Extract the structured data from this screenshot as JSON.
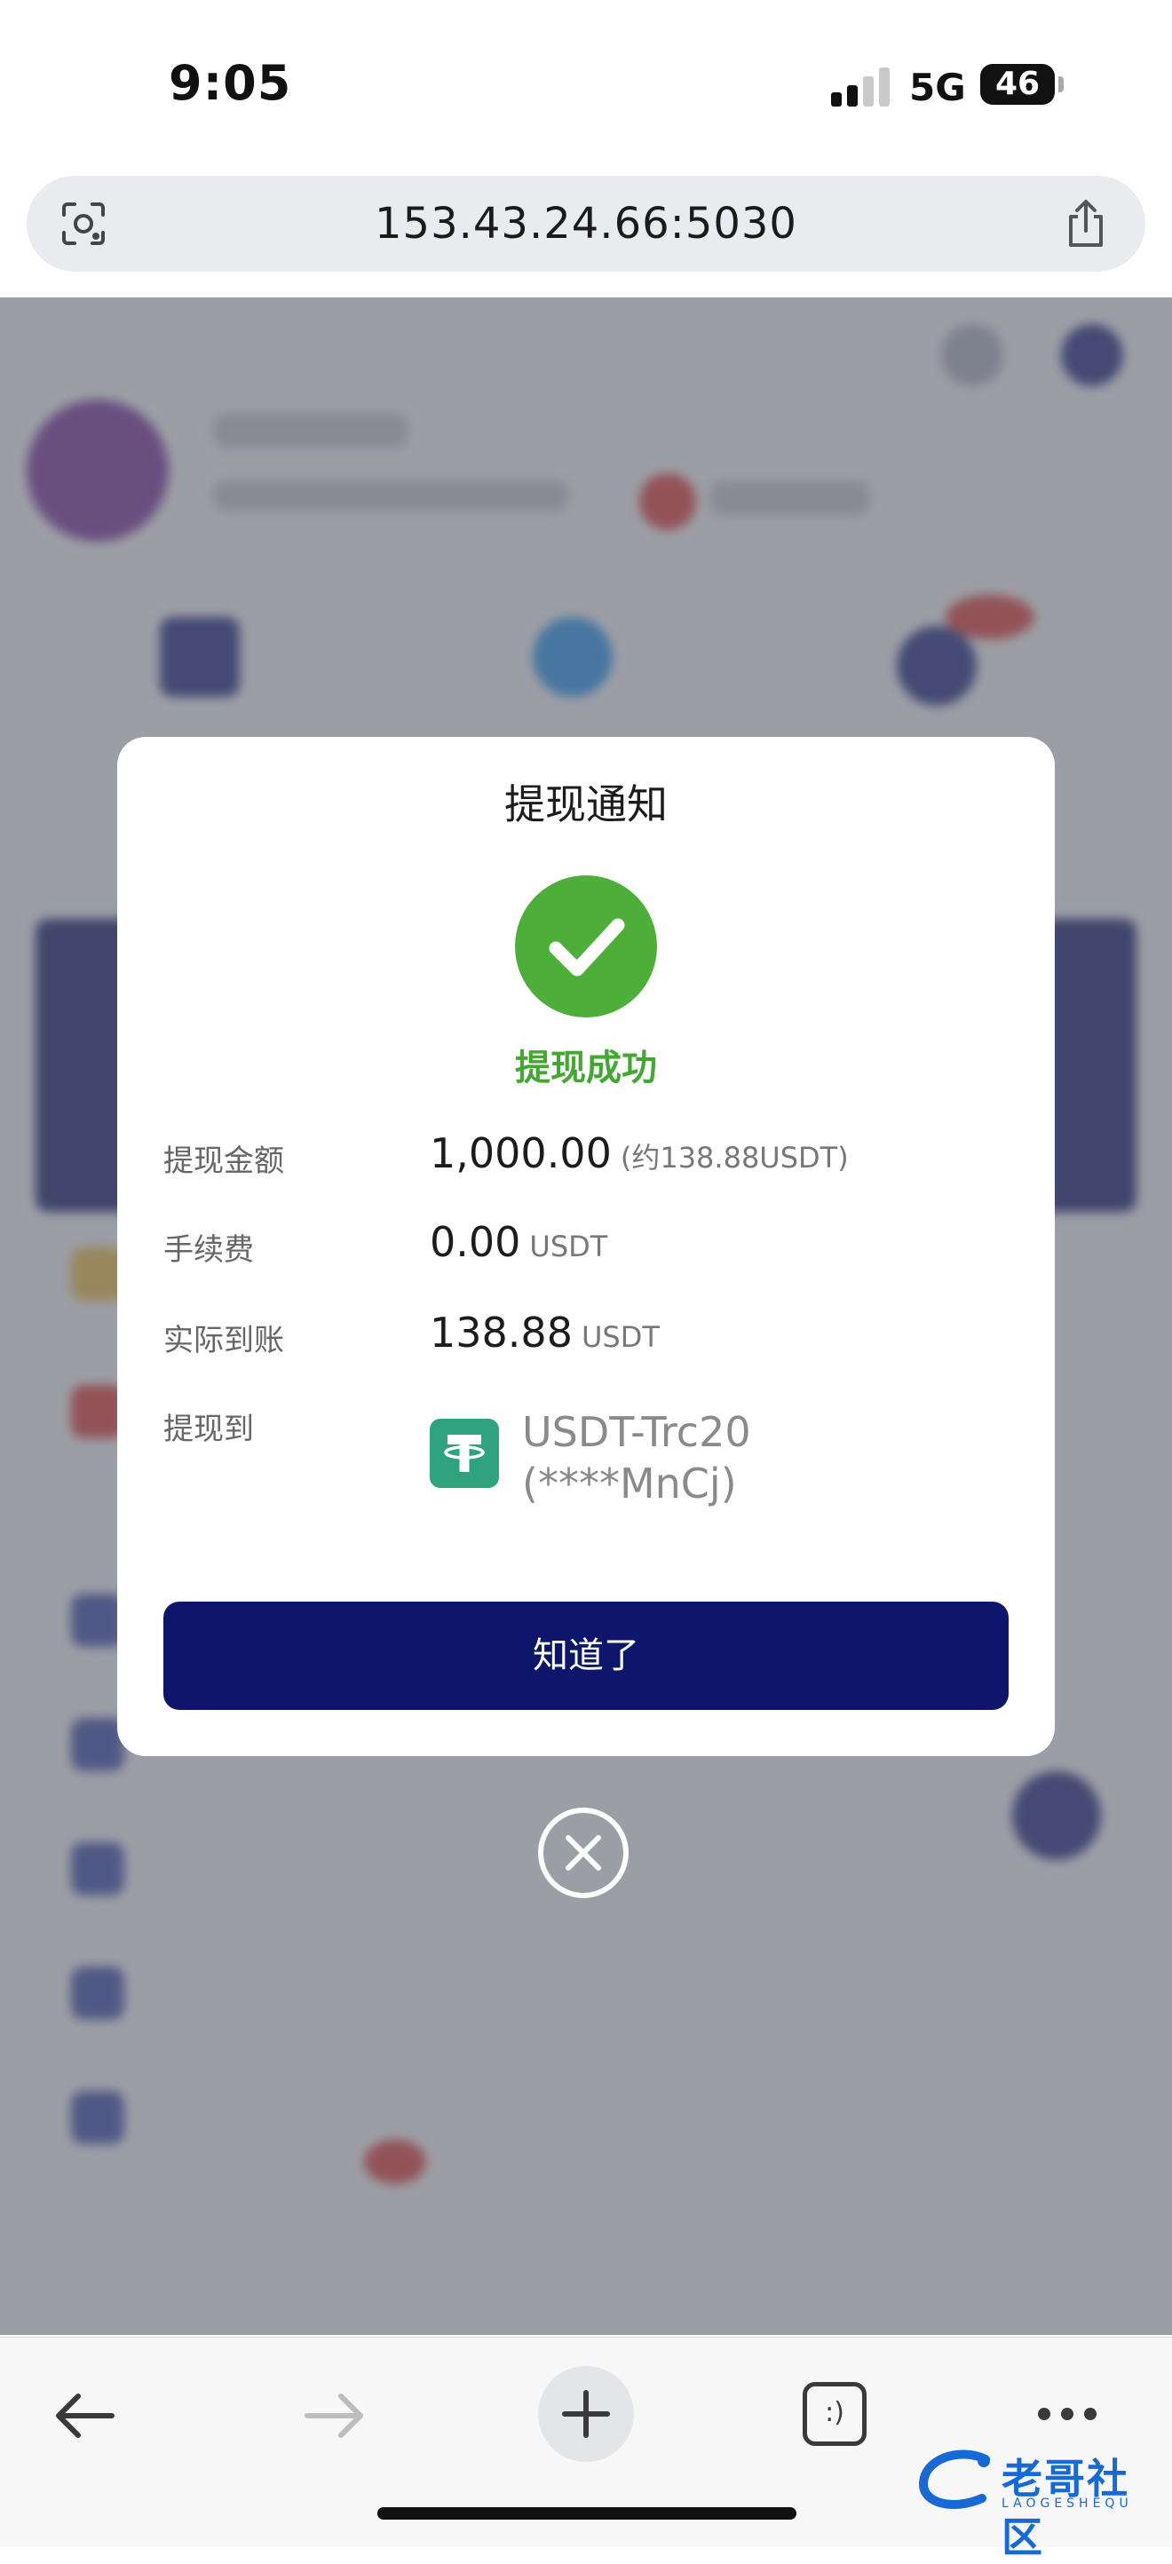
{
  "status_bar": {
    "time": "9:05",
    "network": "5G",
    "battery": "46"
  },
  "browser": {
    "url": "153.43.24.66:5030"
  },
  "modal": {
    "title": "提现通知",
    "status": "提现成功",
    "rows": [
      {
        "label": "提现金额",
        "value": "1,000.00",
        "unit": "(约138.88USDT)"
      },
      {
        "label": "手续费",
        "value": "0.00",
        "unit": "USDT"
      },
      {
        "label": "实际到账",
        "value": "138.88",
        "unit": "USDT"
      }
    ],
    "destination_label": "提现到",
    "destination_line1": "USDT-Trc20",
    "destination_line2": "(****MnCj)",
    "confirm_button": "知道了"
  },
  "toolbar": {
    "tabs_icon_text": ":)"
  },
  "watermark": {
    "text": "老哥社区",
    "sub": "LAOGESHEQU"
  },
  "colors": {
    "success": "#4eae3a",
    "primary_button": "#0d166a",
    "usdt_green": "#2ea37d",
    "overlay": "rgba(95,98,110,0.62)"
  },
  "icons": [
    "lens-icon",
    "share-icon",
    "check-icon",
    "tether-icon",
    "close-circle-icon",
    "back-arrow-icon",
    "forward-arrow-icon",
    "plus-icon",
    "tabs-icon",
    "more-icon"
  ]
}
